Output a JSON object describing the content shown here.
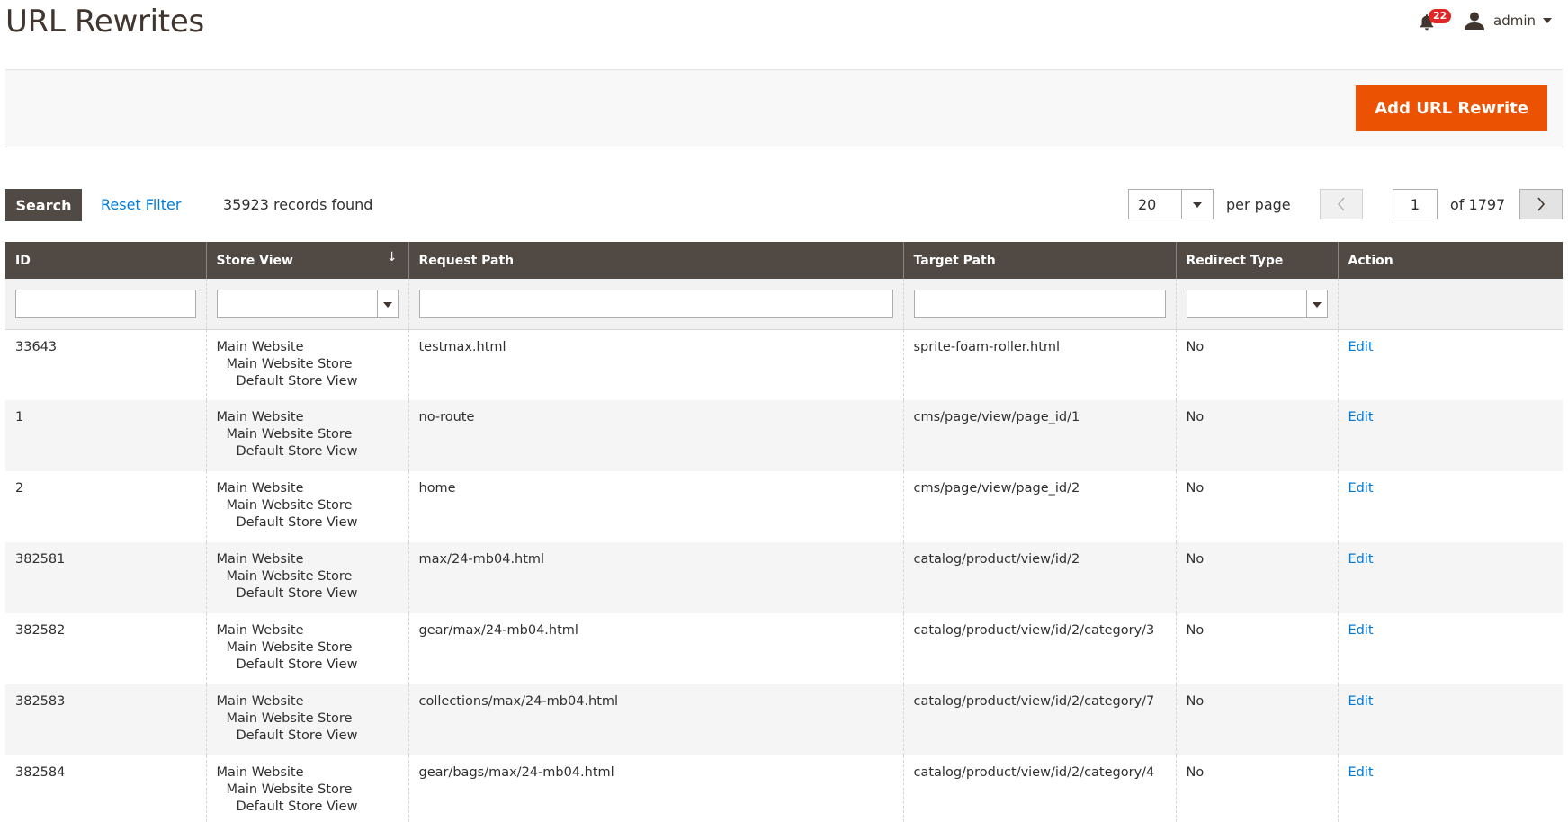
{
  "header": {
    "title": "URL Rewrites",
    "notification_count": "22",
    "user_name": "admin"
  },
  "actions": {
    "add_label": "Add URL Rewrite"
  },
  "toolbar": {
    "search_label": "Search",
    "reset_label": "Reset Filter",
    "records_text": "35923 records found",
    "per_page_value": "20",
    "per_page_label": "per page",
    "current_page": "1",
    "of_pages": "of 1797"
  },
  "columns": [
    "ID",
    "Store View",
    "Request Path",
    "Target Path",
    "Redirect Type",
    "Action"
  ],
  "rows": [
    {
      "id": "33643",
      "store": [
        "Main Website",
        "Main Website Store",
        "Default Store View"
      ],
      "request": "testmax.html",
      "target": "sprite-foam-roller.html",
      "redirect": "No",
      "action": "Edit"
    },
    {
      "id": "1",
      "store": [
        "Main Website",
        "Main Website Store",
        "Default Store View"
      ],
      "request": "no-route",
      "target": "cms/page/view/page_id/1",
      "redirect": "No",
      "action": "Edit"
    },
    {
      "id": "2",
      "store": [
        "Main Website",
        "Main Website Store",
        "Default Store View"
      ],
      "request": "home",
      "target": "cms/page/view/page_id/2",
      "redirect": "No",
      "action": "Edit"
    },
    {
      "id": "382581",
      "store": [
        "Main Website",
        "Main Website Store",
        "Default Store View"
      ],
      "request": "max/24-mb04.html",
      "target": "catalog/product/view/id/2",
      "redirect": "No",
      "action": "Edit"
    },
    {
      "id": "382582",
      "store": [
        "Main Website",
        "Main Website Store",
        "Default Store View"
      ],
      "request": "gear/max/24-mb04.html",
      "target": "catalog/product/view/id/2/category/3",
      "redirect": "No",
      "action": "Edit"
    },
    {
      "id": "382583",
      "store": [
        "Main Website",
        "Main Website Store",
        "Default Store View"
      ],
      "request": "collections/max/24-mb04.html",
      "target": "catalog/product/view/id/2/category/7",
      "redirect": "No",
      "action": "Edit"
    },
    {
      "id": "382584",
      "store": [
        "Main Website",
        "Main Website Store",
        "Default Store View"
      ],
      "request": "gear/bags/max/24-mb04.html",
      "target": "catalog/product/view/id/2/category/4",
      "redirect": "No",
      "action": "Edit"
    }
  ]
}
